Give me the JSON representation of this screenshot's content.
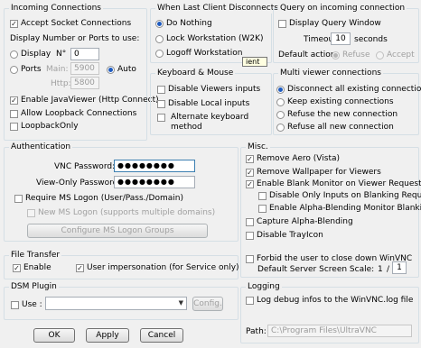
{
  "incoming": {
    "title": "Incoming Connections",
    "accept_socket": "Accept Socket Connections",
    "display_ports_label": "Display Number or Ports to use:",
    "display_label": "Display",
    "display_no_label": "N°",
    "display_no_value": "0",
    "ports_label": "Ports",
    "main_label": "Main:",
    "main_value": "5900",
    "auto_label": "Auto",
    "http_label": "Http:",
    "http_value": "5800",
    "enable_java": "Enable JavaViewer (Http Connect)",
    "allow_loopback": "Allow Loopback Connections",
    "loopback_only": "LoopbackOnly"
  },
  "disconnect": {
    "title": "When Last Client Disconnects",
    "do_nothing": "Do Nothing",
    "lock": "Lock Workstation (W2K)",
    "logoff": "Logoff Workstation"
  },
  "query": {
    "title": "Query on incoming connection",
    "display_query": "Display Query Window",
    "timeout_label": "Timeout:",
    "timeout_value": "10",
    "seconds_label": "seconds",
    "default_action_label": "Default action:",
    "refuse_label": "Refuse",
    "accept_label": "Accept"
  },
  "tooltip_fragment": "ient",
  "keyboard": {
    "title": "Keyboard & Mouse",
    "disable_viewer_inputs": "Disable Viewers inputs",
    "disable_local_inputs": "Disable Local inputs",
    "alt_keyboard_line1": "Alternate keyboard",
    "alt_keyboard_line2": "method"
  },
  "multiviewer": {
    "title": "Multi viewer connections",
    "disconnect_all": "Disconnect all existing connections",
    "keep_existing": "Keep existing connections",
    "refuse_new": "Refuse the new connection",
    "refuse_all": "Refuse all new connection"
  },
  "auth": {
    "title": "Authentication",
    "vnc_password_label": "VNC Password:",
    "vnc_password_value": "●●●●●●●●",
    "view_only_label": "View-Only Password:",
    "view_only_value": "●●●●●●●●",
    "require_ms_logon": "Require MS Logon  (User/Pass./Domain)",
    "new_ms_logon": "New MS Logon (supports multiple domains)",
    "configure_button": "Configure MS Logon Groups"
  },
  "misc": {
    "title": "Misc.",
    "remove_aero": "Remove Aero (Vista)",
    "remove_wallpaper": "Remove Wallpaper for Viewers",
    "enable_blank": "Enable Blank Monitor on Viewer Request",
    "disable_only_inputs": "Disable Only Inputs on Blanking Request",
    "enable_alpha_blending": "Enable Alpha-Blending Monitor Blanking",
    "capture_alpha": "Capture Alpha-Blending",
    "disable_tray": "Disable TrayIcon",
    "forbid_close": "Forbid the user to close down WinVNC",
    "default_scale_label": "Default Server Screen Scale:",
    "scale_numerator": "1",
    "scale_separator": "/",
    "scale_denominator": "1"
  },
  "file_transfer": {
    "title": "File Transfer",
    "enable": "Enable",
    "user_impersonation": "User impersonation (for Service only)"
  },
  "dsm": {
    "title": "DSM Plugin",
    "use_label": "Use :",
    "select_value": "",
    "config_button": "Config."
  },
  "logging": {
    "title": "Logging",
    "log_debug": "Log debug infos to the WinVNC.log file",
    "path_label": "Path:",
    "path_value": "C:\\Program Files\\UltraVNC"
  },
  "buttons": {
    "ok": "OK",
    "apply": "Apply",
    "cancel": "Cancel"
  },
  "colors": {
    "group_border": "#d5dfe5",
    "radio_selected": "#1e5bbf",
    "dialog_bg": "#f0f0f0"
  },
  "icons": {
    "checkbox": "check-mark",
    "dropdown": "chevron-down-icon"
  }
}
